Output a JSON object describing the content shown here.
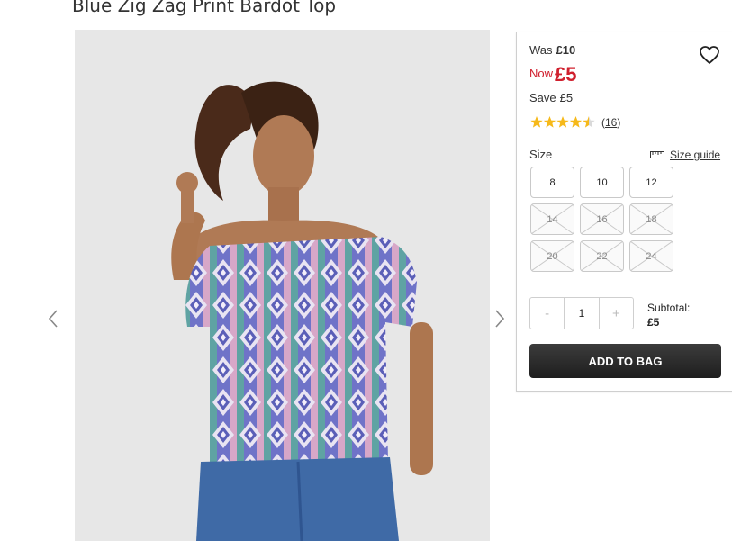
{
  "product": {
    "title": "Blue Zig Zag Print Bardot Top"
  },
  "price": {
    "was_label": "Was",
    "was_value": "£10",
    "now_label": "Now",
    "now_value": "£5",
    "save_label": "Save",
    "save_value": "£5"
  },
  "rating": {
    "stars": 4.5,
    "open_paren": "(",
    "count": "16",
    "close_paren": ")",
    "star_color": "#f6b91a"
  },
  "size": {
    "label": "Size",
    "guide_label": "Size guide",
    "options": [
      {
        "label": "8",
        "available": true
      },
      {
        "label": "10",
        "available": true
      },
      {
        "label": "12",
        "available": true
      },
      {
        "label": "14",
        "available": false
      },
      {
        "label": "16",
        "available": false
      },
      {
        "label": "18",
        "available": false
      },
      {
        "label": "20",
        "available": false
      },
      {
        "label": "22",
        "available": false
      },
      {
        "label": "24",
        "available": false
      }
    ]
  },
  "quantity": {
    "minus": "-",
    "value": "1",
    "plus": "+"
  },
  "subtotal": {
    "label": "Subtotal:",
    "value": "£5"
  },
  "cart": {
    "add_label": "ADD TO BAG"
  },
  "colors": {
    "price_red": "#d0202e",
    "button_dark": "#2a2a2a"
  },
  "icons": {
    "wishlist": "heart-icon",
    "prev": "chevron-left-icon",
    "next": "chevron-right-icon",
    "size_guide": "ruler-icon"
  }
}
